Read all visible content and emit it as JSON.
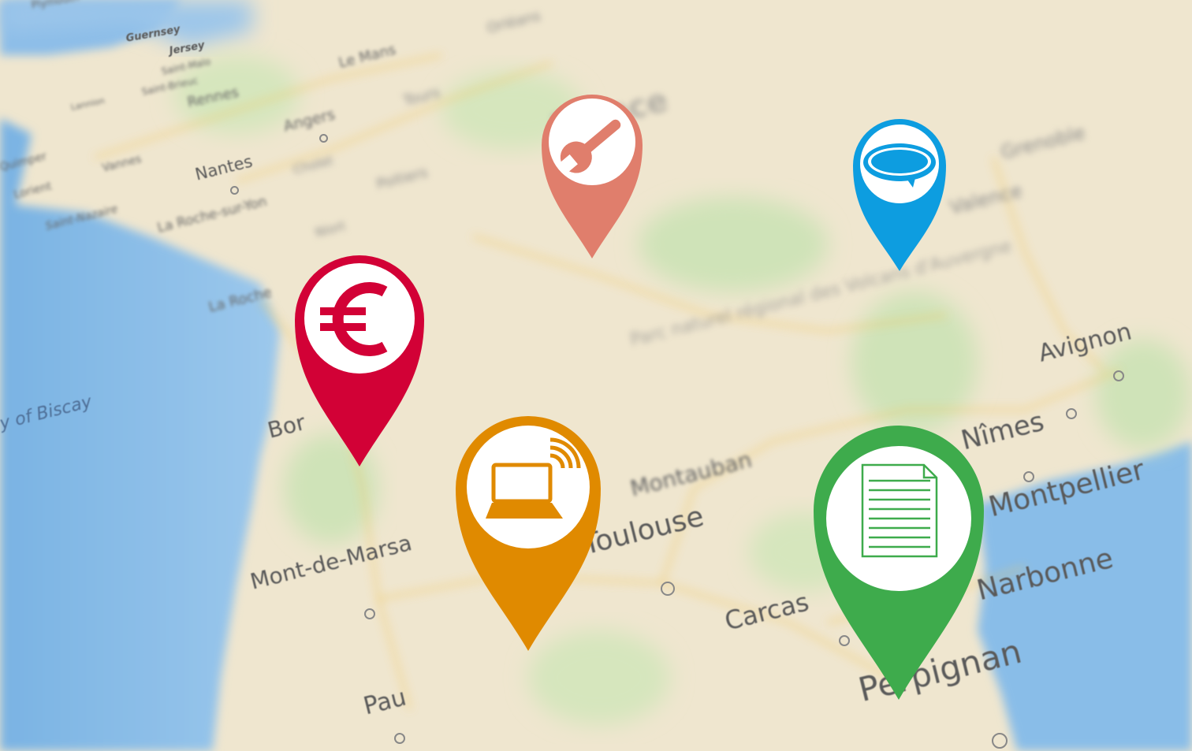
{
  "map": {
    "sea_label": "y of Biscay",
    "cities": [
      {
        "name": "Plymouth"
      },
      {
        "name": "Guernsey"
      },
      {
        "name": "Jersey"
      },
      {
        "name": "Saint-Malo"
      },
      {
        "name": "Saint-Brieuc"
      },
      {
        "name": "Rennes"
      },
      {
        "name": "Le Mans"
      },
      {
        "name": "Orléans"
      },
      {
        "name": "Angers"
      },
      {
        "name": "Tours"
      },
      {
        "name": "Nantes"
      },
      {
        "name": "Cholet"
      },
      {
        "name": "Poitiers"
      },
      {
        "name": "Vannes"
      },
      {
        "name": "Lorient"
      },
      {
        "name": "Quimper"
      },
      {
        "name": "Saint-Nazaire"
      },
      {
        "name": "La Roche-sur-Yon"
      },
      {
        "name": "Niort"
      },
      {
        "name": "La Roche"
      },
      {
        "name": "Bor"
      },
      {
        "name": "Mont-de-Marsa"
      },
      {
        "name": "Pau"
      },
      {
        "name": "Montauban"
      },
      {
        "name": "Toulouse"
      },
      {
        "name": "Carcas"
      },
      {
        "name": "Perpignan"
      },
      {
        "name": "Narbonne"
      },
      {
        "name": "Montpellier"
      },
      {
        "name": "Nîmes"
      },
      {
        "name": "Avignon"
      },
      {
        "name": "Valence"
      },
      {
        "name": "Grenoble"
      },
      {
        "name": "Lannion"
      },
      {
        "name": "Parc naturel régional des Volcans d'Auvergne"
      },
      {
        "name": "France"
      }
    ]
  },
  "pins": [
    {
      "id": "wrench",
      "color": "#e07e6c",
      "icon": "wrench-icon"
    },
    {
      "id": "chat",
      "color": "#0d9de0",
      "icon": "speech-bubble-icon"
    },
    {
      "id": "euro",
      "color": "#d20136",
      "icon": "euro-icon"
    },
    {
      "id": "laptop",
      "color": "#e08a00",
      "icon": "laptop-wifi-icon"
    },
    {
      "id": "document",
      "color": "#3eab4c",
      "icon": "document-icon"
    }
  ]
}
